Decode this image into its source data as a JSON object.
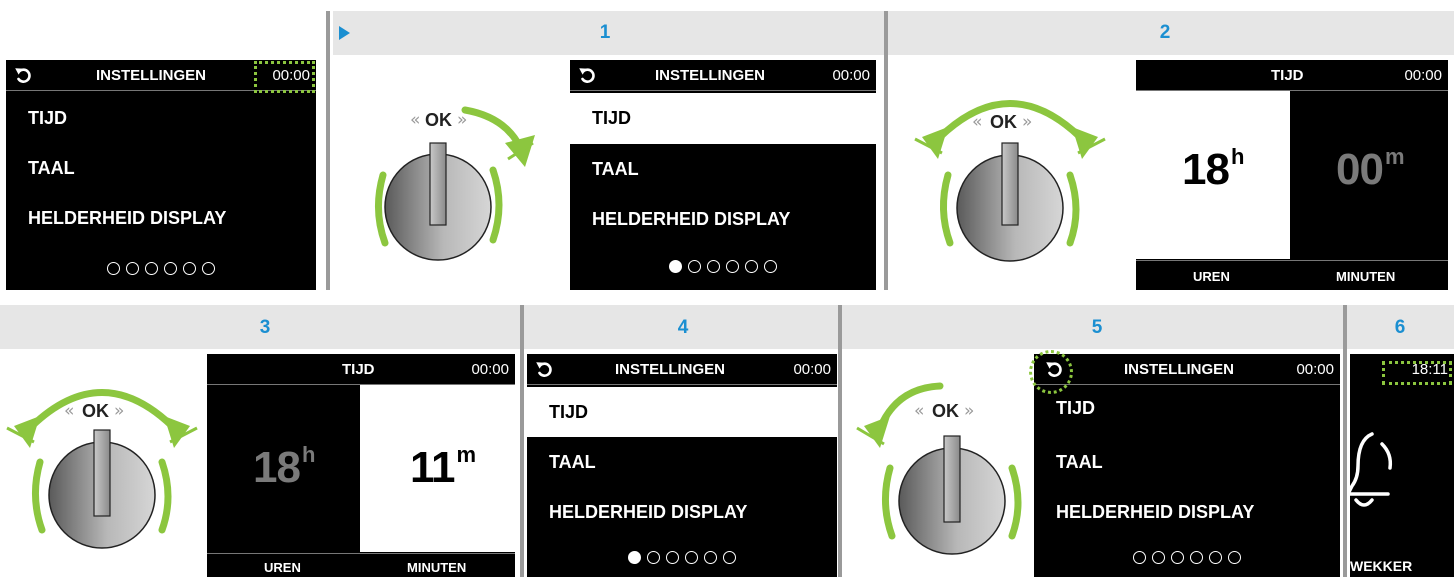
{
  "steps": [
    "1",
    "2",
    "3",
    "4",
    "5",
    "6"
  ],
  "menu": {
    "title": "INSTELLINGEN",
    "items": [
      "TIJD",
      "TAAL",
      "HELDERHEID DISPLAY"
    ]
  },
  "time_screen": {
    "title": "TIJD",
    "hours_label": "UREN",
    "minutes_label": "MINUTEN",
    "hour_unit": "h",
    "minute_unit": "m"
  },
  "knob": {
    "label": "OK"
  },
  "panels": {
    "p0": {
      "clock": "00:00",
      "page_dot": null
    },
    "p1": {
      "clock": "00:00",
      "selected_item": "TAAL",
      "page_dot": 0
    },
    "p2": {
      "clock": "00:00",
      "hours": "18",
      "minutes": "00",
      "active": "hours"
    },
    "p3": {
      "clock": "00:00",
      "hours": "18",
      "minutes": "11",
      "active": "minutes"
    },
    "p4": {
      "clock": "00:00",
      "selected_item": "TAAL",
      "page_dot": 0
    },
    "p5": {
      "clock": "00:00",
      "selected_item": "TIJD",
      "page_dot": null
    },
    "p6": {
      "clock": "18:11",
      "label": "WEKKER"
    }
  },
  "icons": {
    "back": "back-arrow-icon",
    "bell": "alarm-bell-icon",
    "arrow": "rotate-arrow-icon",
    "play": "play-triangle-icon"
  },
  "colors": {
    "accent_green": "#8cc63f",
    "step_blue": "#1b8fd1",
    "band_gray": "#e6e6e6",
    "screen_black": "#000000"
  }
}
